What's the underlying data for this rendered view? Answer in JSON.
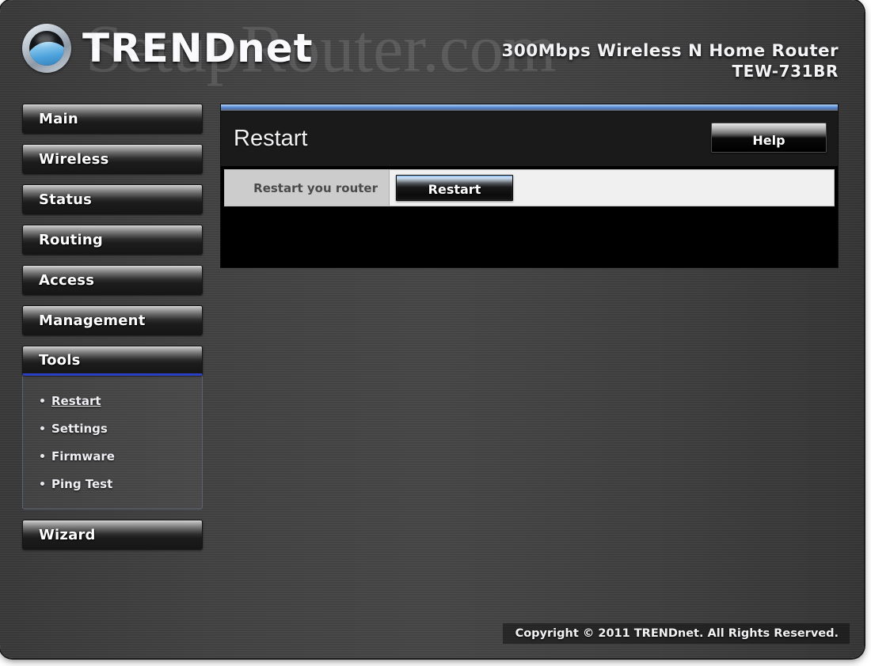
{
  "watermark": {
    "text": "SetupRouter.com"
  },
  "header": {
    "logo_icon": "trendnet-wave-logo-icon",
    "brand_upper": "TREND",
    "brand_lower": "net",
    "product_name": "300Mbps Wireless N Home Router",
    "model": "TEW-731BR"
  },
  "sidebar": {
    "items": [
      {
        "label": "Main",
        "active": false
      },
      {
        "label": "Wireless",
        "active": false
      },
      {
        "label": "Status",
        "active": false
      },
      {
        "label": "Routing",
        "active": false
      },
      {
        "label": "Access",
        "active": false
      },
      {
        "label": "Management",
        "active": false
      },
      {
        "label": "Tools",
        "active": true
      },
      {
        "label": "Wizard",
        "active": false
      }
    ],
    "submenu": [
      {
        "label": "Restart",
        "current": true
      },
      {
        "label": "Settings",
        "current": false
      },
      {
        "label": "Firmware",
        "current": false
      },
      {
        "label": "Ping Test",
        "current": false
      }
    ],
    "active_accent_color": "#2b3fc4"
  },
  "content": {
    "title": "Restart",
    "help_label": "Help",
    "rows": [
      {
        "label": "Restart you router",
        "button_label": "Restart"
      }
    ]
  },
  "footer": {
    "copyright": "Copyright © 2011 TRENDnet. All Rights Reserved."
  }
}
